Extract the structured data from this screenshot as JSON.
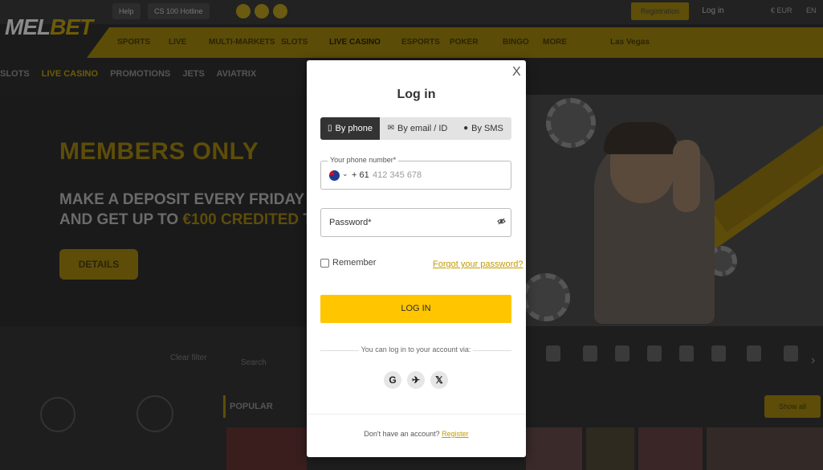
{
  "site": {
    "logo_mel": "MEL",
    "logo_bet": "BET",
    "top_chip_1": "Help",
    "top_chip_2": "CS 100 Hotline",
    "registration": "Registration",
    "login": "Log in",
    "currency": "€ EUR",
    "lang": "EN",
    "nav": [
      "SPORTS",
      "LIVE",
      "MULTI-MARKETS",
      "SLOTS",
      "LIVE CASINO",
      "ESPORTS",
      "POKER",
      "BINGO",
      "MORE",
      "Las Vegas"
    ],
    "subnav": [
      "SLOTS",
      "LIVE CASINO",
      "PROMOTIONS",
      "JETS",
      "AVIATRIX"
    ],
    "hero": {
      "title": "MEMBERS ONLY",
      "line1": "MAKE A DEPOSIT EVERY FRIDAY",
      "line2_a": "AND GET UP TO ",
      "line2_hl": "€100 CREDITED",
      "line2_b": " TO",
      "details": "DETAILS"
    },
    "clear_filter": "Clear filter",
    "search": "Search",
    "popular": "POPULAR",
    "show_all": "Show all"
  },
  "modal": {
    "close": "X",
    "title": "Log in",
    "tabs": [
      {
        "icon": "▯",
        "label": "By phone"
      },
      {
        "icon": "✉",
        "label": "By email / ID"
      },
      {
        "icon": "●",
        "label": "By SMS"
      }
    ],
    "phone_label": "Your phone number*",
    "country_prefix": "+ 61",
    "phone_placeholder": "412 345 678",
    "password_placeholder": "Password*",
    "remember": "Remember",
    "forgot": "Forgot your password?",
    "login_button": "LOG IN",
    "via_text": "You can log in to your account via:",
    "social": [
      "G",
      "✈",
      "𝕏"
    ],
    "no_account": "Don't have an account? ",
    "register": "Register"
  }
}
